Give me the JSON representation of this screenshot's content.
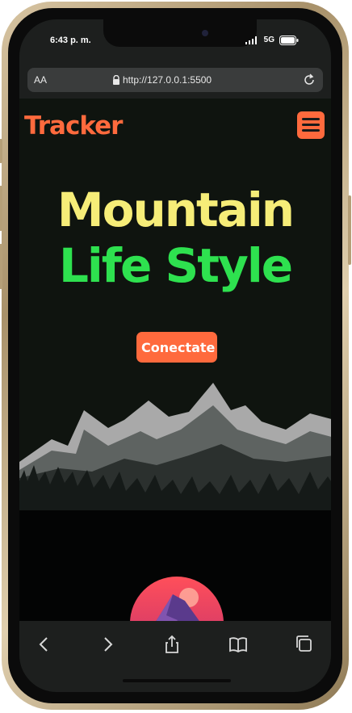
{
  "status": {
    "time": "6:43 p. m.",
    "network": "5G"
  },
  "browser": {
    "text_size_label": "AA",
    "url": "http://127.0.0.1:5500"
  },
  "page": {
    "brand": "Tracker",
    "hero_line1": "Mountain",
    "hero_line2": "Life Style",
    "cta_label": "Conectate"
  },
  "toolbar": {
    "icons": [
      "back-icon",
      "forward-icon",
      "share-icon",
      "bookmarks-icon",
      "tabs-icon"
    ]
  },
  "colors": {
    "accent": "#ff6a3d",
    "hero_yellow": "#f6ed78",
    "hero_green": "#2ee14f",
    "background": "#0f140f"
  }
}
